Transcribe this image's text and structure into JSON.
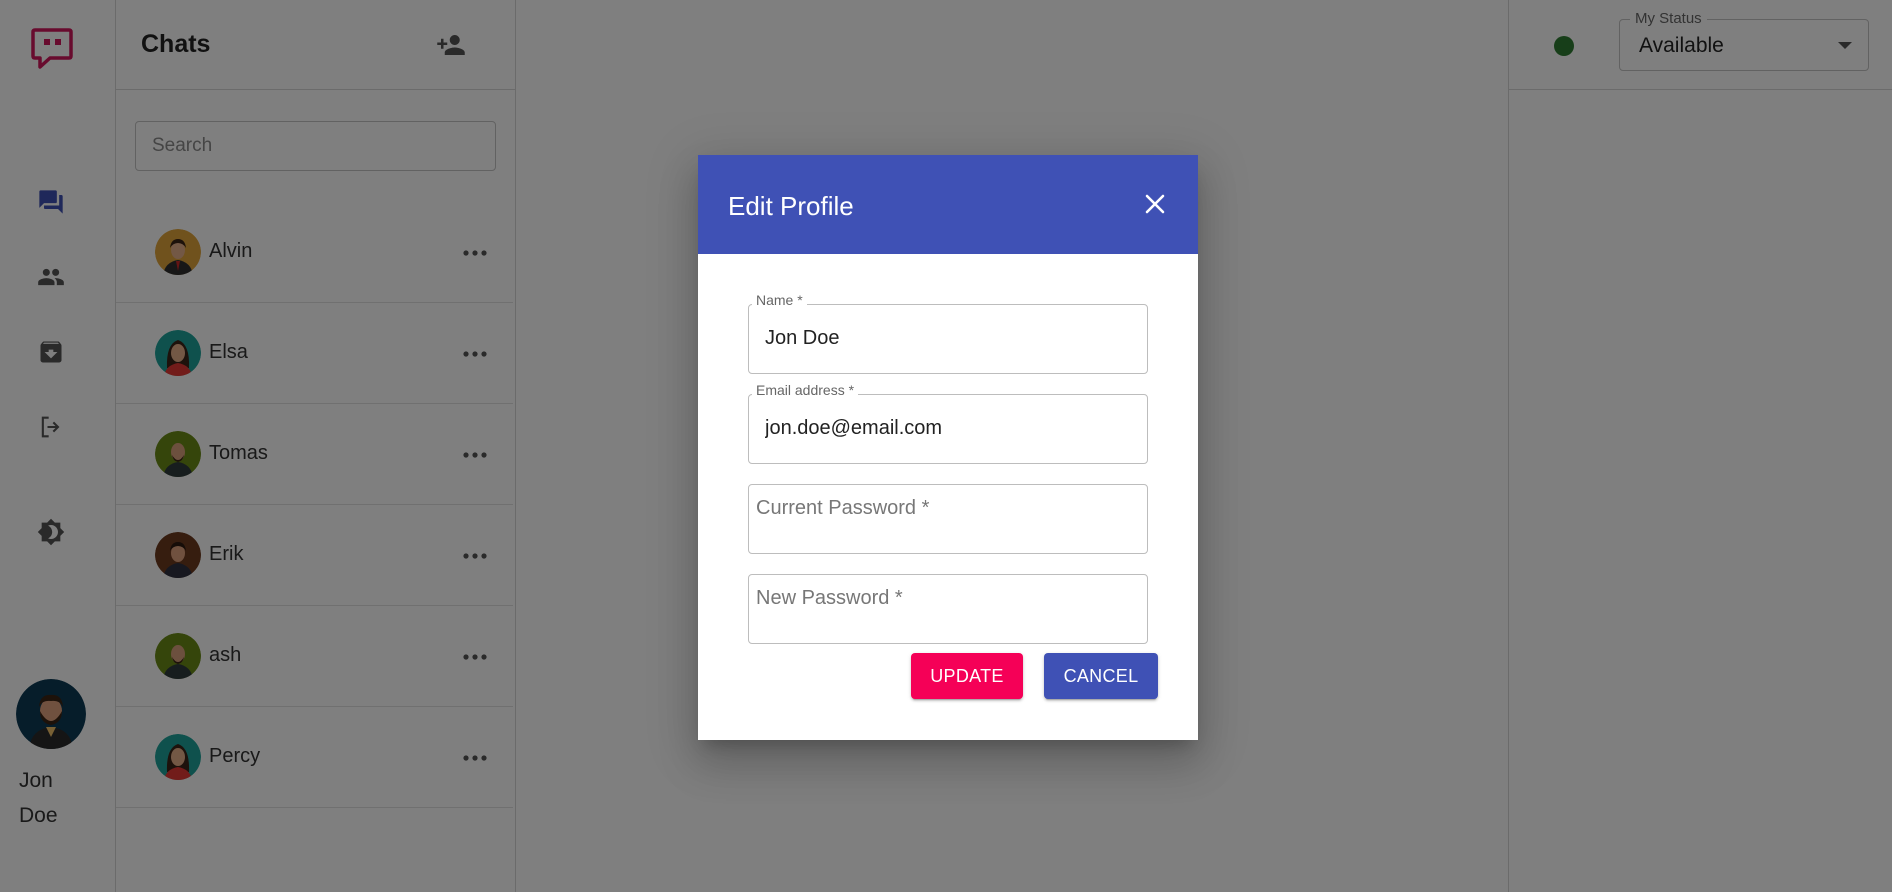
{
  "colors": {
    "brand": "#d1175c",
    "primary": "#3f51b5",
    "accent": "#f50057",
    "status_online": "#2e7d32"
  },
  "nav": {
    "logo_icon": "chat-bubble-logo-icon",
    "items": [
      {
        "icon": "chat-icon",
        "active": true
      },
      {
        "icon": "contacts-icon",
        "active": false
      },
      {
        "icon": "archive-icon",
        "active": false
      },
      {
        "icon": "logout-icon",
        "active": false
      },
      {
        "icon": "theme-toggle-icon",
        "active": false
      }
    ],
    "user": {
      "first_name": "Jon",
      "last_name": "Doe"
    }
  },
  "chats": {
    "title": "Chats",
    "add_contact_icon": "add-person-icon",
    "search_placeholder": "Search",
    "items": [
      {
        "name": "Alvin"
      },
      {
        "name": "Elsa"
      },
      {
        "name": "Tomas"
      },
      {
        "name": "Erik"
      },
      {
        "name": "ash"
      },
      {
        "name": "Percy"
      }
    ]
  },
  "status": {
    "legend": "My Status",
    "value": "Available"
  },
  "dialog": {
    "title": "Edit Profile",
    "fields": {
      "name": {
        "label": "Name *",
        "value": "Jon Doe"
      },
      "email": {
        "label": "Email address *",
        "value": "jon.doe@email.com"
      },
      "current_password": {
        "placeholder": "Current Password *"
      },
      "new_password": {
        "placeholder": "New Password *"
      }
    },
    "update_label": "UPDATE",
    "cancel_label": "CANCEL"
  }
}
